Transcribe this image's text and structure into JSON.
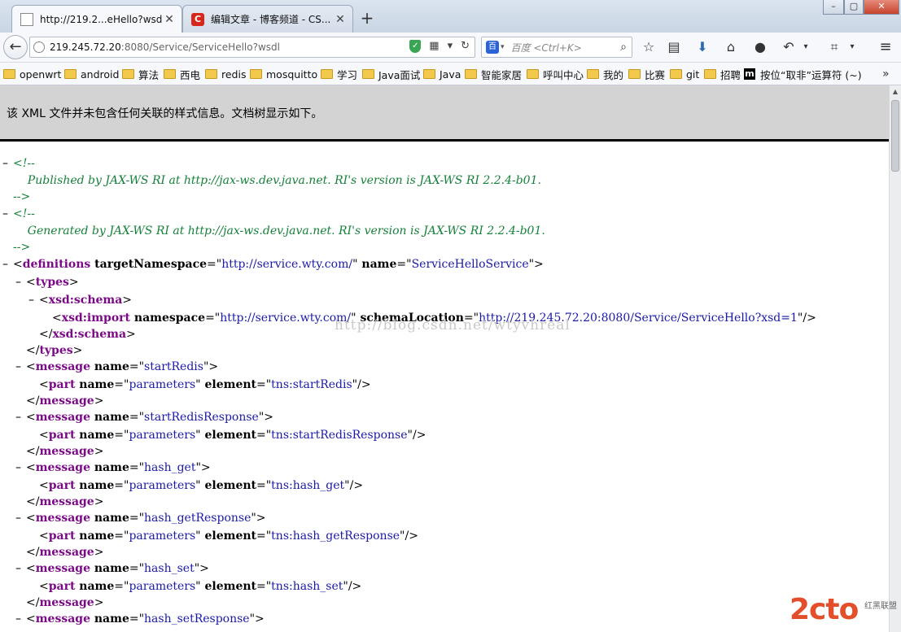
{
  "browser": {
    "tabs": [
      {
        "title": "http://219.2...eHello?wsdl",
        "active": true
      },
      {
        "title": "编辑文章 - 博客频道 - CS...",
        "active": false
      }
    ],
    "new_tab": "+",
    "url_host": "219.245.72.20",
    "url_path": ":8080/Service/ServiceHello?wsdl",
    "search_engine_label": "百度",
    "search_placeholder": "<Ctrl+K>",
    "window_controls": [
      "–",
      "▢",
      "✕"
    ]
  },
  "bookmarks": [
    {
      "label": "openwrt",
      "icon": "folder-icon"
    },
    {
      "label": "android",
      "icon": "folder-icon"
    },
    {
      "label": "算法",
      "icon": "folder-icon"
    },
    {
      "label": "西电",
      "icon": "folder-icon"
    },
    {
      "label": "redis",
      "icon": "folder-icon"
    },
    {
      "label": "mosquitto",
      "icon": "folder-icon"
    },
    {
      "label": "学习",
      "icon": "folder-icon"
    },
    {
      "label": "Java面试",
      "icon": "folder-icon"
    },
    {
      "label": "Java",
      "icon": "folder-icon"
    },
    {
      "label": "智能家居",
      "icon": "folder-icon"
    },
    {
      "label": "呼叫中心",
      "icon": "folder-icon"
    },
    {
      "label": "我的",
      "icon": "folder-icon"
    },
    {
      "label": "比赛",
      "icon": "folder-icon"
    },
    {
      "label": "git",
      "icon": "folder-icon"
    },
    {
      "label": "招聘",
      "icon": "folder-icon"
    },
    {
      "label": "按位“取非”运算符 (~)",
      "icon": "m-logo-icon"
    }
  ],
  "page": {
    "notice": "该 XML 文件并未包含任何关联的样式信息。文档树显示如下。",
    "watermark": "http://blog.csdn.net/wtyvhreal",
    "logo_big": "2cto",
    "logo_small": "红黑联盟",
    "xml_lines": [
      {
        "toggle": "–",
        "segs": [
          {
            "c": "cm",
            "t": "<!--"
          }
        ]
      },
      {
        "segs": [
          {
            "c": "cm",
            "t": "    Published by JAX-WS RI at http://jax-ws.dev.java.net. RI's version is JAX-WS RI 2.2.4-b01."
          }
        ]
      },
      {
        "segs": [
          {
            "c": "cm",
            "t": "-->"
          }
        ]
      },
      {
        "toggle": "–",
        "segs": [
          {
            "c": "cm",
            "t": "<!--"
          }
        ]
      },
      {
        "segs": [
          {
            "c": "cm",
            "t": "    Generated by JAX-WS RI at http://jax-ws.dev.java.net. RI's version is JAX-WS RI 2.2.4-b01."
          }
        ]
      },
      {
        "segs": [
          {
            "c": "cm",
            "t": "-->"
          }
        ]
      },
      {
        "toggle": "–",
        "segs": [
          {
            "c": "tg",
            "t": "<"
          },
          {
            "c": "kw",
            "t": "definitions"
          },
          {
            "c": "at",
            "t": " targetNamespace"
          },
          {
            "c": "tg",
            "t": "=\""
          },
          {
            "c": "vl",
            "t": "http://service.wty.com/"
          },
          {
            "c": "tg",
            "t": "\""
          },
          {
            "c": "at",
            "t": " name"
          },
          {
            "c": "tg",
            "t": "=\""
          },
          {
            "c": "vl",
            "t": "ServiceHelloService"
          },
          {
            "c": "tg",
            "t": "\">"
          }
        ]
      },
      {
        "toggle": "–",
        "segs": [
          {
            "c": "tg",
            "t": "<"
          },
          {
            "c": "kw",
            "t": "types"
          },
          {
            "c": "tg",
            "t": ">"
          }
        ]
      },
      {
        "toggle": "–",
        "segs": [
          {
            "c": "tg",
            "t": "<"
          },
          {
            "c": "kw",
            "t": "xsd:schema"
          },
          {
            "c": "tg",
            "t": ">"
          }
        ]
      },
      {
        "segs": [
          {
            "c": "tg",
            "t": "<"
          },
          {
            "c": "kw",
            "t": "xsd:import"
          },
          {
            "c": "at",
            "t": " namespace"
          },
          {
            "c": "tg",
            "t": "=\""
          },
          {
            "c": "vl",
            "t": "http://service.wty.com/"
          },
          {
            "c": "tg",
            "t": "\""
          },
          {
            "c": "at",
            "t": " schemaLocation"
          },
          {
            "c": "tg",
            "t": "=\""
          },
          {
            "c": "vl",
            "t": "http://219.245.72.20:8080/Service/ServiceHello?xsd=1"
          },
          {
            "c": "tg",
            "t": "\"/>"
          }
        ]
      },
      {
        "segs": [
          {
            "c": "tg",
            "t": "</"
          },
          {
            "c": "kw",
            "t": "xsd:schema"
          },
          {
            "c": "tg",
            "t": ">"
          }
        ]
      },
      {
        "segs": [
          {
            "c": "tg",
            "t": "</"
          },
          {
            "c": "kw",
            "t": "types"
          },
          {
            "c": "tg",
            "t": ">"
          }
        ]
      },
      {
        "toggle": "–",
        "segs": [
          {
            "c": "tg",
            "t": "<"
          },
          {
            "c": "kw",
            "t": "message"
          },
          {
            "c": "at",
            "t": " name"
          },
          {
            "c": "tg",
            "t": "=\""
          },
          {
            "c": "vl",
            "t": "startRedis"
          },
          {
            "c": "tg",
            "t": "\">"
          }
        ]
      },
      {
        "segs": [
          {
            "c": "tg",
            "t": "<"
          },
          {
            "c": "kw",
            "t": "part"
          },
          {
            "c": "at",
            "t": " name"
          },
          {
            "c": "tg",
            "t": "=\""
          },
          {
            "c": "vl",
            "t": "parameters"
          },
          {
            "c": "tg",
            "t": "\""
          },
          {
            "c": "at",
            "t": " element"
          },
          {
            "c": "tg",
            "t": "=\""
          },
          {
            "c": "vl",
            "t": "tns:startRedis"
          },
          {
            "c": "tg",
            "t": "\"/>"
          }
        ]
      },
      {
        "segs": [
          {
            "c": "tg",
            "t": "</"
          },
          {
            "c": "kw",
            "t": "message"
          },
          {
            "c": "tg",
            "t": ">"
          }
        ]
      },
      {
        "toggle": "–",
        "segs": [
          {
            "c": "tg",
            "t": "<"
          },
          {
            "c": "kw",
            "t": "message"
          },
          {
            "c": "at",
            "t": " name"
          },
          {
            "c": "tg",
            "t": "=\""
          },
          {
            "c": "vl",
            "t": "startRedisResponse"
          },
          {
            "c": "tg",
            "t": "\">"
          }
        ]
      },
      {
        "segs": [
          {
            "c": "tg",
            "t": "<"
          },
          {
            "c": "kw",
            "t": "part"
          },
          {
            "c": "at",
            "t": " name"
          },
          {
            "c": "tg",
            "t": "=\""
          },
          {
            "c": "vl",
            "t": "parameters"
          },
          {
            "c": "tg",
            "t": "\""
          },
          {
            "c": "at",
            "t": " element"
          },
          {
            "c": "tg",
            "t": "=\""
          },
          {
            "c": "vl",
            "t": "tns:startRedisResponse"
          },
          {
            "c": "tg",
            "t": "\"/>"
          }
        ]
      },
      {
        "segs": [
          {
            "c": "tg",
            "t": "</"
          },
          {
            "c": "kw",
            "t": "message"
          },
          {
            "c": "tg",
            "t": ">"
          }
        ]
      },
      {
        "toggle": "–",
        "segs": [
          {
            "c": "tg",
            "t": "<"
          },
          {
            "c": "kw",
            "t": "message"
          },
          {
            "c": "at",
            "t": " name"
          },
          {
            "c": "tg",
            "t": "=\""
          },
          {
            "c": "vl",
            "t": "hash_get"
          },
          {
            "c": "tg",
            "t": "\">"
          }
        ]
      },
      {
        "segs": [
          {
            "c": "tg",
            "t": "<"
          },
          {
            "c": "kw",
            "t": "part"
          },
          {
            "c": "at",
            "t": " name"
          },
          {
            "c": "tg",
            "t": "=\""
          },
          {
            "c": "vl",
            "t": "parameters"
          },
          {
            "c": "tg",
            "t": "\""
          },
          {
            "c": "at",
            "t": " element"
          },
          {
            "c": "tg",
            "t": "=\""
          },
          {
            "c": "vl",
            "t": "tns:hash_get"
          },
          {
            "c": "tg",
            "t": "\"/>"
          }
        ]
      },
      {
        "segs": [
          {
            "c": "tg",
            "t": "</"
          },
          {
            "c": "kw",
            "t": "message"
          },
          {
            "c": "tg",
            "t": ">"
          }
        ]
      },
      {
        "toggle": "–",
        "segs": [
          {
            "c": "tg",
            "t": "<"
          },
          {
            "c": "kw",
            "t": "message"
          },
          {
            "c": "at",
            "t": " name"
          },
          {
            "c": "tg",
            "t": "=\""
          },
          {
            "c": "vl",
            "t": "hash_getResponse"
          },
          {
            "c": "tg",
            "t": "\">"
          }
        ]
      },
      {
        "segs": [
          {
            "c": "tg",
            "t": "<"
          },
          {
            "c": "kw",
            "t": "part"
          },
          {
            "c": "at",
            "t": " name"
          },
          {
            "c": "tg",
            "t": "=\""
          },
          {
            "c": "vl",
            "t": "parameters"
          },
          {
            "c": "tg",
            "t": "\""
          },
          {
            "c": "at",
            "t": " element"
          },
          {
            "c": "tg",
            "t": "=\""
          },
          {
            "c": "vl",
            "t": "tns:hash_getResponse"
          },
          {
            "c": "tg",
            "t": "\"/>"
          }
        ]
      },
      {
        "segs": [
          {
            "c": "tg",
            "t": "</"
          },
          {
            "c": "kw",
            "t": "message"
          },
          {
            "c": "tg",
            "t": ">"
          }
        ]
      },
      {
        "toggle": "–",
        "segs": [
          {
            "c": "tg",
            "t": "<"
          },
          {
            "c": "kw",
            "t": "message"
          },
          {
            "c": "at",
            "t": " name"
          },
          {
            "c": "tg",
            "t": "=\""
          },
          {
            "c": "vl",
            "t": "hash_set"
          },
          {
            "c": "tg",
            "t": "\">"
          }
        ]
      },
      {
        "segs": [
          {
            "c": "tg",
            "t": "<"
          },
          {
            "c": "kw",
            "t": "part"
          },
          {
            "c": "at",
            "t": " name"
          },
          {
            "c": "tg",
            "t": "=\""
          },
          {
            "c": "vl",
            "t": "parameters"
          },
          {
            "c": "tg",
            "t": "\""
          },
          {
            "c": "at",
            "t": " element"
          },
          {
            "c": "tg",
            "t": "=\""
          },
          {
            "c": "vl",
            "t": "tns:hash_set"
          },
          {
            "c": "tg",
            "t": "\"/>"
          }
        ]
      },
      {
        "segs": [
          {
            "c": "tg",
            "t": "</"
          },
          {
            "c": "kw",
            "t": "message"
          },
          {
            "c": "tg",
            "t": ">"
          }
        ]
      },
      {
        "toggle": "–",
        "segs": [
          {
            "c": "tg",
            "t": "<"
          },
          {
            "c": "kw",
            "t": "message"
          },
          {
            "c": "at",
            "t": " name"
          },
          {
            "c": "tg",
            "t": "=\""
          },
          {
            "c": "vl",
            "t": "hash_setResponse"
          },
          {
            "c": "tg",
            "t": "\">"
          }
        ]
      }
    ]
  }
}
